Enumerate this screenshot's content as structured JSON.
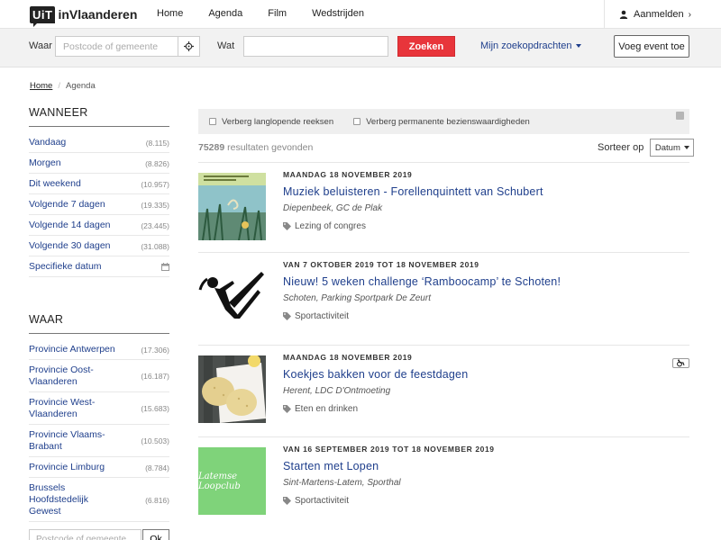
{
  "header": {
    "logo_box": "UiT",
    "logo_text": "inVlaanderen",
    "nav": [
      "Home",
      "Agenda",
      "Film",
      "Wedstrijden"
    ],
    "login_label": "Aanmelden"
  },
  "search": {
    "where_label": "Waar",
    "where_placeholder": "Postcode of gemeente",
    "what_label": "Wat",
    "what_value": "",
    "search_button": "Zoeken",
    "my_searches": "Mijn zoekopdrachten",
    "add_event": "Voeg event toe"
  },
  "breadcrumb": {
    "home": "Home",
    "current": "Agenda"
  },
  "sidebar": {
    "when_heading": "WANNEER",
    "when_items": [
      {
        "label": "Vandaag",
        "count": "(8.115)"
      },
      {
        "label": "Morgen",
        "count": "(8.826)"
      },
      {
        "label": "Dit weekend",
        "count": "(10.957)"
      },
      {
        "label": "Volgende 7 dagen",
        "count": "(19.335)"
      },
      {
        "label": "Volgende 14 dagen",
        "count": "(23.445)"
      },
      {
        "label": "Volgende 30 dagen",
        "count": "(31.088)"
      },
      {
        "label": "Specifieke datum",
        "icon": "calendar-icon"
      }
    ],
    "where_heading": "WAAR",
    "where_items": [
      {
        "label": "Provincie Antwerpen",
        "count": "(17.306)"
      },
      {
        "label": "Provincie Oost-Vlaanderen",
        "count": "(16.187)"
      },
      {
        "label": "Provincie West-Vlaanderen",
        "count": "(15.683)"
      },
      {
        "label": "Provincie Vlaams-Brabant",
        "count": "(10.503)"
      },
      {
        "label": "Provincie Limburg",
        "count": "(8.784)"
      },
      {
        "label": "Brussels Hoofdstedelijk Gewest",
        "count": "(6.816)"
      }
    ],
    "postcode_placeholder": "Postcode of gemeente",
    "ok_button": "Ok"
  },
  "filters": {
    "long_series": "Verberg langlopende reeksen",
    "permanent": "Verberg permanente bezienswaardigheden"
  },
  "results": {
    "count": "75289",
    "label": "resultaten gevonden"
  },
  "sort": {
    "label": "Sorteer op",
    "value": "Datum"
  },
  "events": [
    {
      "date": "MAANDAG 18 NOVEMBER 2019",
      "title": "Muziek beluisteren - Forellenquintett van Schubert",
      "location": "Diepenbeek, GC de Plak",
      "tag": "Lezing of congres"
    },
    {
      "date": "VAN 7 OKTOBER 2019 TOT 18 NOVEMBER 2019",
      "title": "Nieuw! 5 weken challenge ‘Ramboocamp’ te Schoten!",
      "location": "Schoten, Parking Sportpark De Zeurt",
      "tag": "Sportactiviteit"
    },
    {
      "date": "MAANDAG 18 NOVEMBER 2019",
      "title": "Koekjes bakken voor de feestdagen",
      "location": "Herent, LDC D'Ontmoeting",
      "tag": "Eten en drinken"
    },
    {
      "date": "VAN 16 SEPTEMBER 2019 TOT 18 NOVEMBER 2019",
      "title": "Starten met Lopen",
      "location": "Sint-Martens-Latem, Sporthal",
      "tag": "Sportactiviteit",
      "thumb_text": "Latemse Loopclub"
    }
  ],
  "colors": {
    "accent": "#e8353b",
    "link": "#1f3f8c",
    "thumb_green": "#7fd37a"
  }
}
